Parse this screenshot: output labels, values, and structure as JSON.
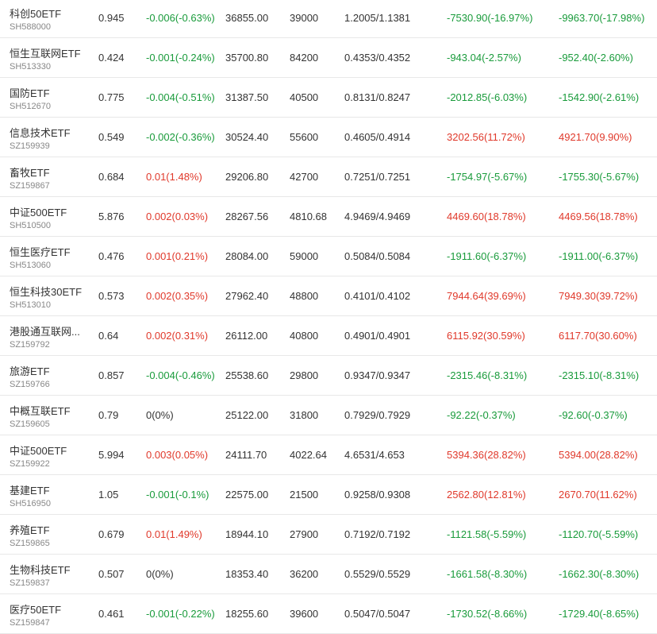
{
  "colors": {
    "up": "#e0392b",
    "down": "#199b3b",
    "flat": "#333333"
  },
  "rows": [
    {
      "name": "科创50ETF",
      "code": "SH588000",
      "price": "0.945",
      "change": "-0.006(-0.63%)",
      "change_dir": "down",
      "scale": "36855.00",
      "volume": "39000",
      "nav": "1.2005/1.1381",
      "inflow": "-7530.90(-16.97%)",
      "inflow_dir": "down",
      "inflow2": "-9963.70(-17.98%)",
      "inflow2_dir": "down"
    },
    {
      "name": "恒生互联网ETF",
      "code": "SH513330",
      "price": "0.424",
      "change": "-0.001(-0.24%)",
      "change_dir": "down",
      "scale": "35700.80",
      "volume": "84200",
      "nav": "0.4353/0.4352",
      "inflow": "-943.04(-2.57%)",
      "inflow_dir": "down",
      "inflow2": "-952.40(-2.60%)",
      "inflow2_dir": "down"
    },
    {
      "name": "国防ETF",
      "code": "SH512670",
      "price": "0.775",
      "change": "-0.004(-0.51%)",
      "change_dir": "down",
      "scale": "31387.50",
      "volume": "40500",
      "nav": "0.8131/0.8247",
      "inflow": "-2012.85(-6.03%)",
      "inflow_dir": "down",
      "inflow2": "-1542.90(-2.61%)",
      "inflow2_dir": "down"
    },
    {
      "name": "信息技术ETF",
      "code": "SZ159939",
      "price": "0.549",
      "change": "-0.002(-0.36%)",
      "change_dir": "down",
      "scale": "30524.40",
      "volume": "55600",
      "nav": "0.4605/0.4914",
      "inflow": "3202.56(11.72%)",
      "inflow_dir": "up",
      "inflow2": "4921.70(9.90%)",
      "inflow2_dir": "up"
    },
    {
      "name": "畜牧ETF",
      "code": "SZ159867",
      "price": "0.684",
      "change": "0.01(1.48%)",
      "change_dir": "up",
      "scale": "29206.80",
      "volume": "42700",
      "nav": "0.7251/0.7251",
      "inflow": "-1754.97(-5.67%)",
      "inflow_dir": "down",
      "inflow2": "-1755.30(-5.67%)",
      "inflow2_dir": "down"
    },
    {
      "name": "中证500ETF",
      "code": "SH510500",
      "price": "5.876",
      "change": "0.002(0.03%)",
      "change_dir": "up",
      "scale": "28267.56",
      "volume": "4810.68",
      "nav": "4.9469/4.9469",
      "inflow": "4469.60(18.78%)",
      "inflow_dir": "up",
      "inflow2": "4469.56(18.78%)",
      "inflow2_dir": "up"
    },
    {
      "name": "恒生医疗ETF",
      "code": "SH513060",
      "price": "0.476",
      "change": "0.001(0.21%)",
      "change_dir": "up",
      "scale": "28084.00",
      "volume": "59000",
      "nav": "0.5084/0.5084",
      "inflow": "-1911.60(-6.37%)",
      "inflow_dir": "down",
      "inflow2": "-1911.00(-6.37%)",
      "inflow2_dir": "down"
    },
    {
      "name": "恒生科技30ETF",
      "code": "SH513010",
      "price": "0.573",
      "change": "0.002(0.35%)",
      "change_dir": "up",
      "scale": "27962.40",
      "volume": "48800",
      "nav": "0.4101/0.4102",
      "inflow": "7944.64(39.69%)",
      "inflow_dir": "up",
      "inflow2": "7949.30(39.72%)",
      "inflow2_dir": "up"
    },
    {
      "name": "港股通互联网...",
      "code": "SZ159792",
      "price": "0.64",
      "change": "0.002(0.31%)",
      "change_dir": "up",
      "scale": "26112.00",
      "volume": "40800",
      "nav": "0.4901/0.4901",
      "inflow": "6115.92(30.59%)",
      "inflow_dir": "up",
      "inflow2": "6117.70(30.60%)",
      "inflow2_dir": "up"
    },
    {
      "name": "旅游ETF",
      "code": "SZ159766",
      "price": "0.857",
      "change": "-0.004(-0.46%)",
      "change_dir": "down",
      "scale": "25538.60",
      "volume": "29800",
      "nav": "0.9347/0.9347",
      "inflow": "-2315.46(-8.31%)",
      "inflow_dir": "down",
      "inflow2": "-2315.10(-8.31%)",
      "inflow2_dir": "down"
    },
    {
      "name": "中概互联ETF",
      "code": "SZ159605",
      "price": "0.79",
      "change": "0(0%)",
      "change_dir": "flat",
      "scale": "25122.00",
      "volume": "31800",
      "nav": "0.7929/0.7929",
      "inflow": "-92.22(-0.37%)",
      "inflow_dir": "down",
      "inflow2": "-92.60(-0.37%)",
      "inflow2_dir": "down"
    },
    {
      "name": "中证500ETF",
      "code": "SZ159922",
      "price": "5.994",
      "change": "0.003(0.05%)",
      "change_dir": "up",
      "scale": "24111.70",
      "volume": "4022.64",
      "nav": "4.6531/4.653",
      "inflow": "5394.36(28.82%)",
      "inflow_dir": "up",
      "inflow2": "5394.00(28.82%)",
      "inflow2_dir": "up"
    },
    {
      "name": "基建ETF",
      "code": "SH516950",
      "price": "1.05",
      "change": "-0.001(-0.1%)",
      "change_dir": "down",
      "scale": "22575.00",
      "volume": "21500",
      "nav": "0.9258/0.9308",
      "inflow": "2562.80(12.81%)",
      "inflow_dir": "up",
      "inflow2": "2670.70(11.62%)",
      "inflow2_dir": "up"
    },
    {
      "name": "养殖ETF",
      "code": "SZ159865",
      "price": "0.679",
      "change": "0.01(1.49%)",
      "change_dir": "up",
      "scale": "18944.10",
      "volume": "27900",
      "nav": "0.7192/0.7192",
      "inflow": "-1121.58(-5.59%)",
      "inflow_dir": "down",
      "inflow2": "-1120.70(-5.59%)",
      "inflow2_dir": "down"
    },
    {
      "name": "生物科技ETF",
      "code": "SZ159837",
      "price": "0.507",
      "change": "0(0%)",
      "change_dir": "flat",
      "scale": "18353.40",
      "volume": "36200",
      "nav": "0.5529/0.5529",
      "inflow": "-1661.58(-8.30%)",
      "inflow_dir": "down",
      "inflow2": "-1662.30(-8.30%)",
      "inflow2_dir": "down"
    },
    {
      "name": "医疗50ETF",
      "code": "SZ159847",
      "price": "0.461",
      "change": "-0.001(-0.22%)",
      "change_dir": "down",
      "scale": "18255.60",
      "volume": "39600",
      "nav": "0.5047/0.5047",
      "inflow": "-1730.52(-8.66%)",
      "inflow_dir": "down",
      "inflow2": "-1729.40(-8.65%)",
      "inflow2_dir": "down"
    }
  ]
}
